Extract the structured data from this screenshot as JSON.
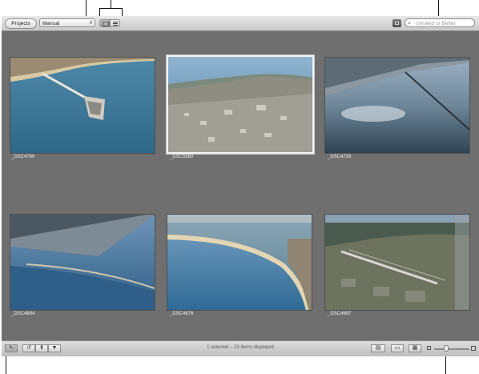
{
  "toolbar": {
    "projects_label": "Projects",
    "sort_value": "Manual",
    "search_placeholder": "Unrated or Better"
  },
  "photos": [
    {
      "name": "_DSC4760",
      "selected": false
    },
    {
      "name": "_DSC5580",
      "selected": true
    },
    {
      "name": "_DSC4733",
      "selected": false
    },
    {
      "name": "_DSC4694",
      "selected": false
    },
    {
      "name": "_DSC4676",
      "selected": false
    },
    {
      "name": "_DSC4687",
      "selected": false
    }
  ],
  "status": {
    "text": "1 selected – 23 items displayed"
  },
  "colors": {
    "background": "#6f6f6f",
    "selection": "#f2f2f2"
  },
  "icons": [
    "grid-view-icon",
    "list-view-icon",
    "browser-icon",
    "search-icon",
    "pointer-icon",
    "rotate-icon",
    "lift-icon",
    "stamp-icon",
    "zoom-slider-icon"
  ]
}
